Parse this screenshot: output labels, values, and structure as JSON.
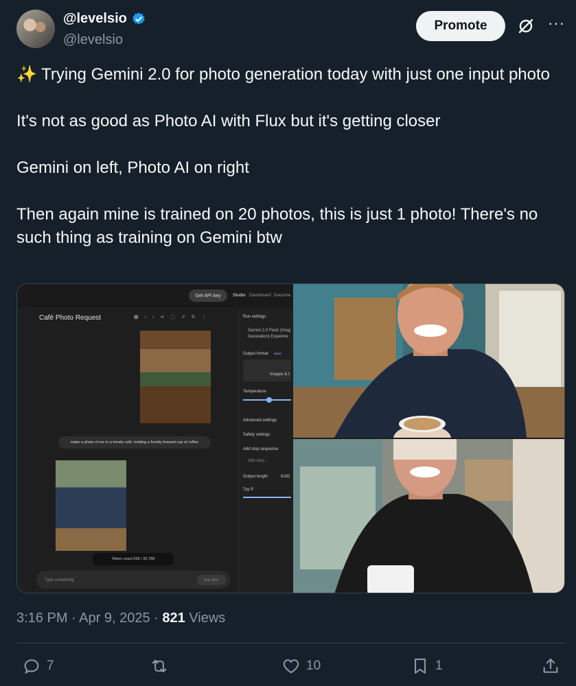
{
  "user": {
    "display_name": "@levelsio",
    "handle": "@levelsio"
  },
  "header": {
    "promote_label": "Promote",
    "grok_icon": "grok-slash-icon",
    "more_icon": "more-dots-icon"
  },
  "tweet": {
    "line1": "✨ Trying Gemini 2.0 for photo generation today with just one input photo",
    "line2": "It's not as good as Photo AI with Flux but it's getting closer",
    "line3": "Gemini on left, Photo AI on right",
    "line4": "Then again mine is trained on 20 photos, this is just 1 photo! There's no such thing as training on Gemini btw"
  },
  "studio": {
    "get_api_key": "Get API key",
    "tab_studio": "Studio",
    "tab_dashboard": "Dashboard",
    "tab_docs": "Docume",
    "chat_title": "Café Photo Request",
    "run_settings": "Run settings",
    "model_line1": "Gemini 2.0 Flash (Imag",
    "model_line2": "Generation) Experime",
    "output_format": "Output format",
    "new_badge": "NEW",
    "images_text": "Images & t",
    "temperature": "Temperature",
    "advanced_settings": "Advanced settings",
    "safety_settings": "Safety settings",
    "add_stop_sequence": "Add stop sequence",
    "add_stop_placeholder": "Add stop...",
    "output_length": "Output length",
    "output_length_value": "8192",
    "top_p": "Top P",
    "prompt": "make a photo of me in a trendy café, holding a freshly brewed cup of coffee",
    "token_count": "Token count 536 / 32,768",
    "input_placeholder": "Type something",
    "run_label": "Run ⌘↵"
  },
  "meta": {
    "time": "3:16 PM",
    "date": "Apr 9, 2025",
    "views_count": "821",
    "views_label": "Views"
  },
  "actions": {
    "replies": "7",
    "reposts": "",
    "likes": "10",
    "bookmarks": "1"
  },
  "colors": {
    "background": "#15202b",
    "secondary_text": "#8b98a5",
    "verified_blue": "#1d9bf0",
    "divider": "#38444d"
  }
}
